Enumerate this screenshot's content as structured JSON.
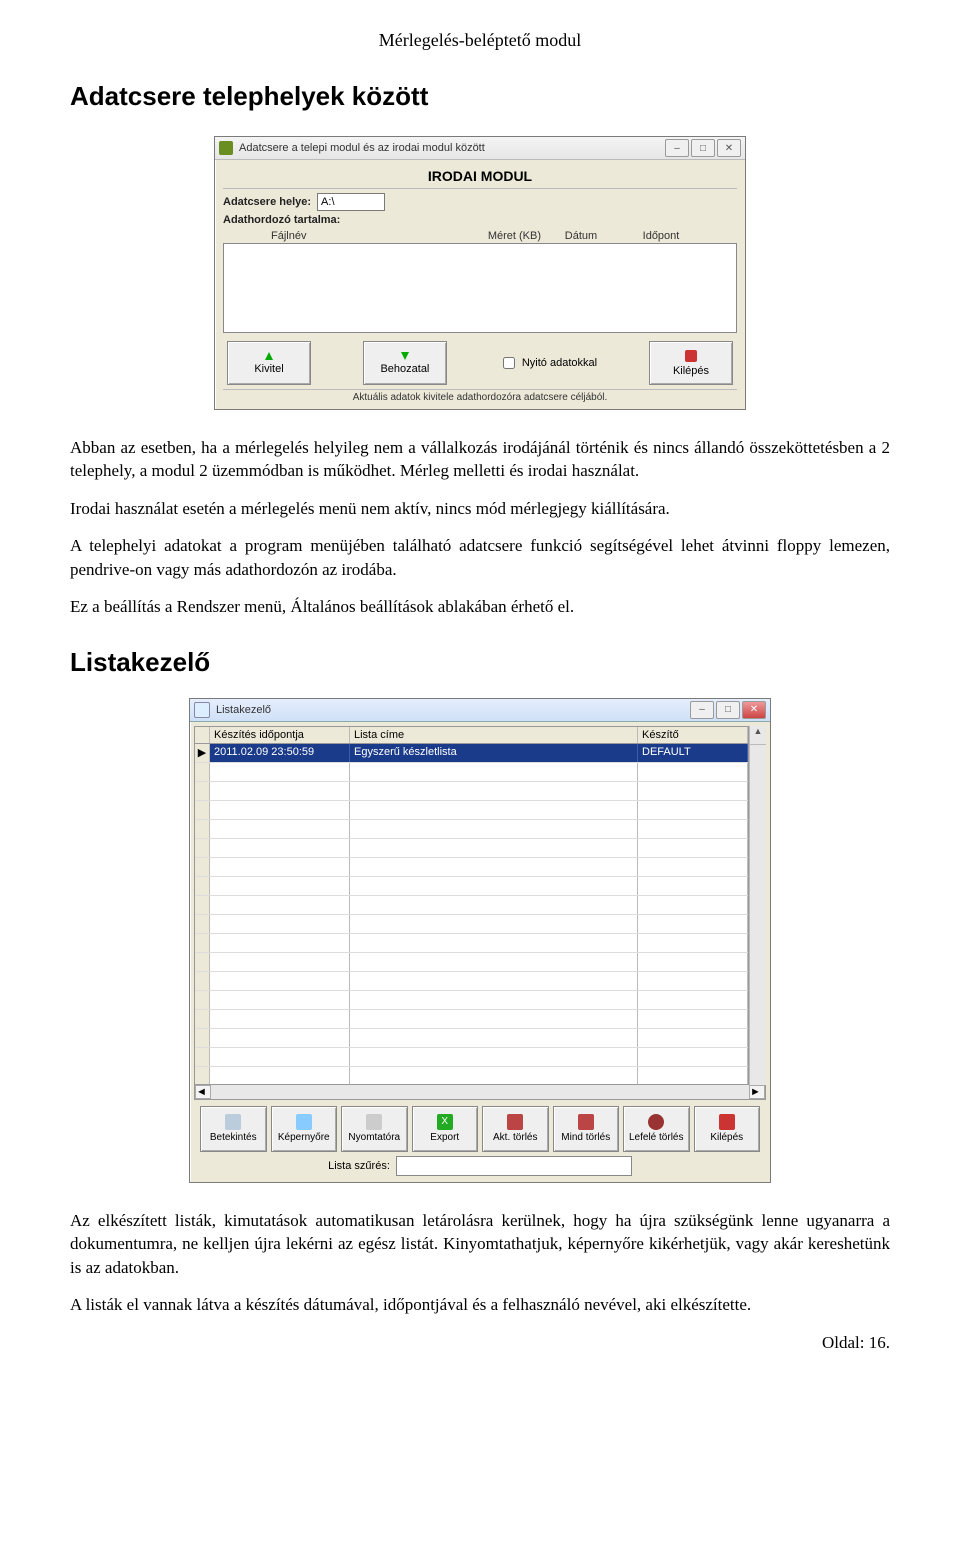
{
  "doc": {
    "header": "Mérlegelés-beléptető modul",
    "h1": "Adatcsere telephelyek között",
    "p1": "Abban az esetben, ha a mérlegelés helyileg nem a vállalkozás irodájánál történik és nincs állandó összeköttetésben a 2 telephely, a modul 2 üzemmódban is működhet. Mérleg melletti és irodai használat.",
    "p2": "Irodai használat esetén a mérlegelés menü nem aktív, nincs mód mérlegjegy kiállítására.",
    "p3": "A telephelyi adatokat a program menüjében található adatcsere funkció segítségével lehet átvinni floppy lemezen, pendrive-on vagy más adathordozón az irodába.",
    "p4": "Ez a beállítás a Rendszer menü, Általános beállítások ablakában érhető el.",
    "h2": "Listakezelő",
    "p5": "Az elkészített listák, kimutatások automatikusan letárolásra kerülnek, hogy ha újra szükségünk lenne ugyanarra a dokumentumra, ne kelljen újra lekérni az egész listát. Kinyomtathatjuk, képernyőre kikérhetjük, vagy akár kereshetünk is az adatokban.",
    "p6": "A listák el vannak látva a készítés dátumával, időpontjával és a felhasználó nevével, aki elkészítette.",
    "footer": "Oldal: 16."
  },
  "fig1": {
    "title": "Adatcsere a telepi modul és az irodai modul között",
    "bigTitle": "IRODAI MODUL",
    "loc_label": "Adatcsere helye:",
    "loc_value": "A:\\",
    "content_label": "Adathordozó tartalma:",
    "cols": {
      "c1": "Fájlnév",
      "c2": "Méret (KB)",
      "c3": "Dátum",
      "c4": "Időpont"
    },
    "btnExport": "Kivitel",
    "btnImport": "Behozatal",
    "chkOpen": "Nyitó adatokkal",
    "btnExit": "Kilépés",
    "status": "Aktuális adatok kivitele adathordozóra adatcsere céljából."
  },
  "fig2": {
    "title": "Listakezelő",
    "cols": {
      "c1": "Készítés időpontja",
      "c2": "Lista címe",
      "c3": "Készítő",
      "scroll": "▲"
    },
    "row": {
      "c1": "2011.02.09 23:50:59",
      "c2": "Egyszerű készletlista",
      "c3": "DEFAULT"
    },
    "toolbar": {
      "b1": "Betekintés",
      "b2": "Képernyőre",
      "b3": "Nyomtatóra",
      "b4": "Export",
      "b5": "Akt. törlés",
      "b6": "Mind törlés",
      "b7": "Lefelé törlés",
      "b8": "Kilépés"
    },
    "filter_label": "Lista szűrés:"
  }
}
